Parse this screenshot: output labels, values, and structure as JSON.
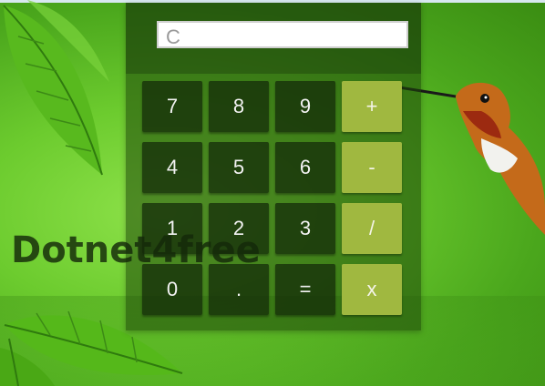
{
  "display": {
    "placeholder": "C",
    "value": ""
  },
  "keypad": {
    "rows": [
      [
        "7",
        "8",
        "9",
        "+"
      ],
      [
        "4",
        "5",
        "6",
        "-"
      ],
      [
        "1",
        "2",
        "3",
        "/"
      ],
      [
        "0",
        ".",
        "=",
        "x"
      ]
    ]
  },
  "watermark": "Dotnet4free",
  "colors": {
    "background": "#7fd13a",
    "number_key": "#1b3208",
    "operator_key": "#a0b840",
    "key_text": "#f2f2f2"
  },
  "icons": [
    "leaf-decoration",
    "hummingbird"
  ]
}
